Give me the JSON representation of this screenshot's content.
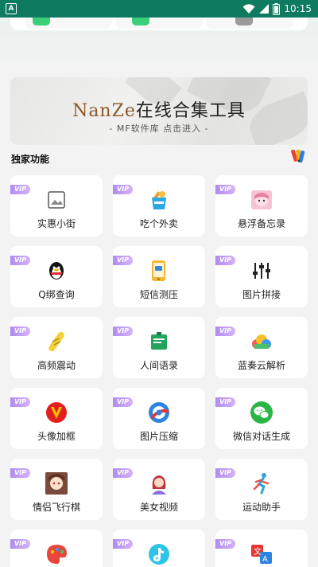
{
  "status_bar": {
    "app_badge": "A",
    "time": "10:15"
  },
  "banner": {
    "title_latin": "NanZe",
    "title_cn": "在线合集工具",
    "subtitle": "- MF软件库 点击进入 -"
  },
  "section": {
    "title": "独家功能",
    "icon": "palette-icon"
  },
  "tiles": [
    {
      "label": "实惠小街",
      "badge": "VIP",
      "icon": "image-placeholder-icon"
    },
    {
      "label": "吃个外卖",
      "badge": "VIP",
      "icon": "food-bag-icon"
    },
    {
      "label": "悬浮备忘录",
      "badge": "VIP",
      "icon": "anime-girl-icon"
    },
    {
      "label": "Q绑查询",
      "badge": "VIP",
      "icon": "qq-penguin-icon"
    },
    {
      "label": "短信测压",
      "badge": "VIP",
      "icon": "phone-message-icon"
    },
    {
      "label": "图片拼接",
      "badge": "VIP",
      "icon": "sliders-icon"
    },
    {
      "label": "高频震动",
      "badge": "VIP",
      "icon": "vibrator-icon"
    },
    {
      "label": "人间语录",
      "badge": "VIP",
      "icon": "notebook-icon"
    },
    {
      "label": "蓝奏云解析",
      "badge": "VIP",
      "icon": "cloud-icon"
    },
    {
      "label": "头像加框",
      "badge": "VIP",
      "icon": "v-badge-icon"
    },
    {
      "label": "图片压缩",
      "badge": "VIP",
      "icon": "compress-icon"
    },
    {
      "label": "微信对话生成",
      "badge": "VIP",
      "icon": "wechat-icon"
    },
    {
      "label": "情侣飞行棋",
      "badge": "VIP",
      "icon": "couple-avatar-icon"
    },
    {
      "label": "美女视频",
      "badge": "VIP",
      "icon": "woman-avatar-icon"
    },
    {
      "label": "运动助手",
      "badge": "VIP",
      "icon": "running-icon"
    },
    {
      "label": "",
      "badge": "VIP",
      "icon": "paint-palette-icon"
    },
    {
      "label": "",
      "badge": "VIP",
      "icon": "tiktok-icon"
    },
    {
      "label": "",
      "badge": "VIP",
      "icon": "translate-icon"
    }
  ]
}
